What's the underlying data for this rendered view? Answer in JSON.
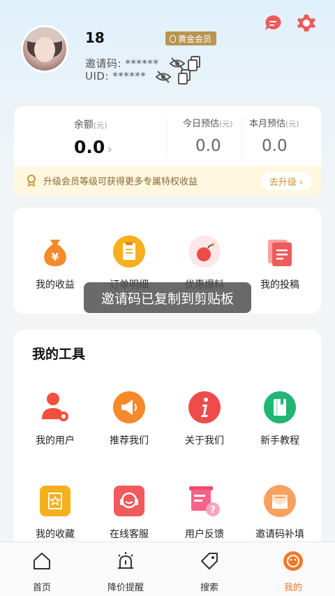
{
  "header": {
    "username": "18",
    "vip_label": "黄金会员",
    "invite_code": "邀请码: ******",
    "uid": "UID: ******"
  },
  "balance": {
    "main_label": "余额",
    "main_unit": "(元)",
    "main_value": "0.0",
    "today_label": "今日预估",
    "today_unit": "(元)",
    "today_value": "0.0",
    "month_label": "本月预估",
    "month_unit": "(元)",
    "month_value": "0.0",
    "upgrade_text": "升级会员等级可获得更多专属特权收益",
    "upgrade_button": "去升级 ›"
  },
  "quick_menu": [
    {
      "label": "我的收益",
      "icon": "money-bag-icon"
    },
    {
      "label": "订单明细",
      "icon": "order-clipboard-icon"
    },
    {
      "label": "优惠爆料",
      "icon": "bomb-icon"
    },
    {
      "label": "我的投稿",
      "icon": "document-icon"
    }
  ],
  "toast": "邀请码已复制到剪贴板",
  "tools": {
    "title": "我的工具",
    "items": [
      {
        "label": "我的用户",
        "icon": "user-settings-icon"
      },
      {
        "label": "推荐我们",
        "icon": "megaphone-icon"
      },
      {
        "label": "关于我们",
        "icon": "info-icon"
      },
      {
        "label": "新手教程",
        "icon": "book-icon"
      },
      {
        "label": "我的收藏",
        "icon": "favorite-icon"
      },
      {
        "label": "在线客服",
        "icon": "customer-service-icon"
      },
      {
        "label": "用户反馈",
        "icon": "feedback-icon"
      },
      {
        "label": "邀请码补填",
        "icon": "envelope-icon"
      }
    ]
  },
  "nav": [
    {
      "label": "首页",
      "icon": "home-icon"
    },
    {
      "label": "降价提醒",
      "icon": "alarm-icon"
    },
    {
      "label": "搜索",
      "icon": "tag-icon"
    },
    {
      "label": "我的",
      "icon": "profile-icon"
    }
  ],
  "colors": {
    "accent": "#f07a2a",
    "gold": "#b89550",
    "message": "#f0595a"
  }
}
